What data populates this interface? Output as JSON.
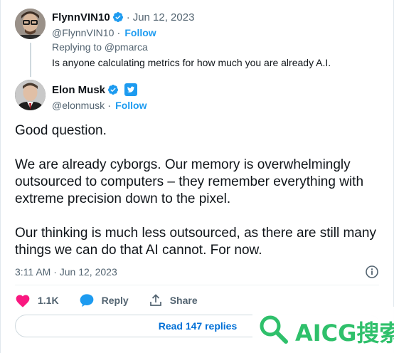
{
  "reply_tweet": {
    "display_name": "FlynnVIN10",
    "date": "Jun 12, 2023",
    "handle": "@FlynnVIN10",
    "follow_label": "Follow",
    "replying_to": "Replying to @pmarca",
    "text": "Is anyone calculating metrics for how much you are already A.I."
  },
  "main_tweet": {
    "display_name": "Elon Musk",
    "handle": "@elonmusk",
    "follow_label": "Follow",
    "paragraphs": [
      "Good question.",
      "We are already cyborgs. Our memory is overwhelmingly outsourced to computers – they remember everything with extreme precision down to the pixel.",
      "Our thinking is much less outsourced, as there are still many things we can do that AI cannot. For now."
    ],
    "timestamp": "3:11 AM · Jun 12, 2023"
  },
  "actions": {
    "like_count": "1.1K",
    "reply_label": "Reply",
    "share_label": "Share"
  },
  "read_replies_label": "Read 147 replies",
  "watermark": {
    "text": "AICG搜索"
  },
  "colors": {
    "accent": "#1d9bf0",
    "like": "#f91880",
    "muted": "#536471",
    "watermark": "#2fc06b"
  }
}
